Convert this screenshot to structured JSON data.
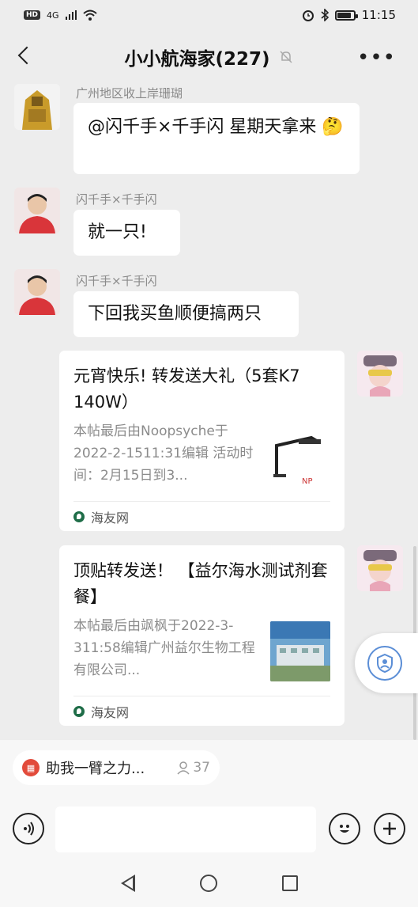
{
  "status_bar": {
    "hd": "HD",
    "network": "4G",
    "time": "11:15"
  },
  "header": {
    "title": "小小航海家(227)"
  },
  "messages": [
    {
      "sender": "广州地区收上岸珊瑚",
      "text": "@闪千手×千手闪 星期天拿来 🤔"
    },
    {
      "sender": "闪千手×千手闪",
      "text": "就一只!"
    },
    {
      "sender": "闪千手×千手闪",
      "text": "下回我买鱼顺便搞两只"
    }
  ],
  "cards": [
    {
      "title": "元宵快乐! 转发送大礼（5套K7  140W）",
      "desc": "本帖最后由Noopsyche于2022-2-1511:31编辑 活动时间：2月15日到3...",
      "source": "海友网"
    },
    {
      "title": "顶贴转发送！ 【益尔海水测试剂套餐】",
      "desc": "本帖最后由飒枫于2022-3-311:58编辑广州益尔生物工程有限公司...",
      "source": "海友网"
    }
  ],
  "pinned": {
    "label": "助我一臂之力...",
    "count": "37"
  },
  "input": {
    "value": ""
  }
}
